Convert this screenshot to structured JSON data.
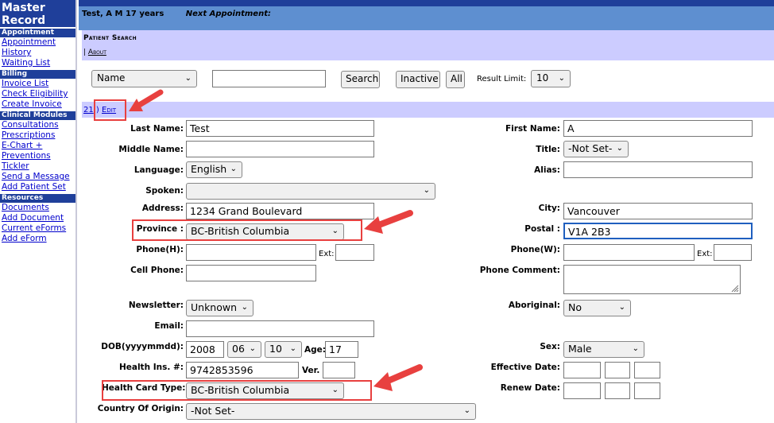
{
  "sidebar": {
    "brand": "Master\nRecord",
    "sections": [
      {
        "title": "Appointment",
        "links": [
          "Appointment",
          "History",
          "Waiting List"
        ]
      },
      {
        "title": "Billing",
        "links": [
          "Invoice List",
          "Check Eligibility",
          "Create Invoice"
        ]
      },
      {
        "title": "Clinical Modules",
        "links": [
          "Consultations",
          "Prescriptions",
          "E-Chart +",
          "Preventions",
          "Tickler",
          "Send a Message",
          "Add Patient Set"
        ]
      },
      {
        "title": "Resources",
        "links": [
          "Documents",
          "Add Document",
          "Current eForms",
          "Add eForm"
        ]
      }
    ]
  },
  "header": {
    "patient": "Test, A M 17 years",
    "next_appointment_label": "Next Appointment:"
  },
  "patient_search": {
    "title": "Patient Search",
    "about": "About",
    "search_by": "Name",
    "search_value": "",
    "search_button": "Search",
    "inactive_button": "Inactive",
    "all_button": "All",
    "result_limit_label": "Result Limit:",
    "result_limit": "10"
  },
  "edit_band": {
    "record_id": "21",
    "edit_link": "Edit"
  },
  "form": {
    "last_name_label": "Last Name:",
    "last_name": "Test",
    "first_name_label": "First Name:",
    "first_name": "A",
    "middle_name_label": "Middle Name:",
    "middle_name": "",
    "title_label": "Title:",
    "title": "-Not Set-",
    "language_label": "Language:",
    "language": "English",
    "alias_label": "Alias:",
    "alias": "",
    "spoken_label": "Spoken:",
    "spoken": "",
    "address_label": "Address:",
    "address": "1234 Grand Boulevard",
    "city_label": "City:",
    "city": "Vancouver",
    "province_label": "Province :",
    "province": "BC-British Columbia",
    "postal_label": "Postal :",
    "postal": "V1A 2B3",
    "phone_h_label": "Phone(H):",
    "phone_h": "",
    "ext_label": "Ext:",
    "phone_w_label": "Phone(W):",
    "phone_w": "",
    "cell_phone_label": "Cell Phone:",
    "cell_phone": "",
    "phone_comment_label": "Phone Comment:",
    "newsletter_label": "Newsletter:",
    "newsletter": "Unknown",
    "aboriginal_label": "Aboriginal:",
    "aboriginal": "No",
    "email_label": "Email:",
    "email": "",
    "dob_label": "DOB(yyyymmdd):",
    "dob_year": "2008",
    "dob_month": "06",
    "dob_day": "10",
    "age_label": "Age:",
    "age": "17",
    "sex_label": "Sex:",
    "sex": "Male",
    "hin_label": "Health Ins. #:",
    "hin": "9742853596",
    "ver_label": "Ver.",
    "effective_date_label": "Effective Date:",
    "health_card_type_label": "Health Card Type:",
    "health_card_type": "BC-British Columbia",
    "renew_date_label": "Renew Date:",
    "country_label": "Country Of Origin:",
    "country": "-Not Set-"
  },
  "colors": {
    "sidebar_brand": "#1f3f9a",
    "header_blue": "#5e8fd0",
    "band_lavender": "#ccccff",
    "annotation_red": "#e8403f"
  }
}
